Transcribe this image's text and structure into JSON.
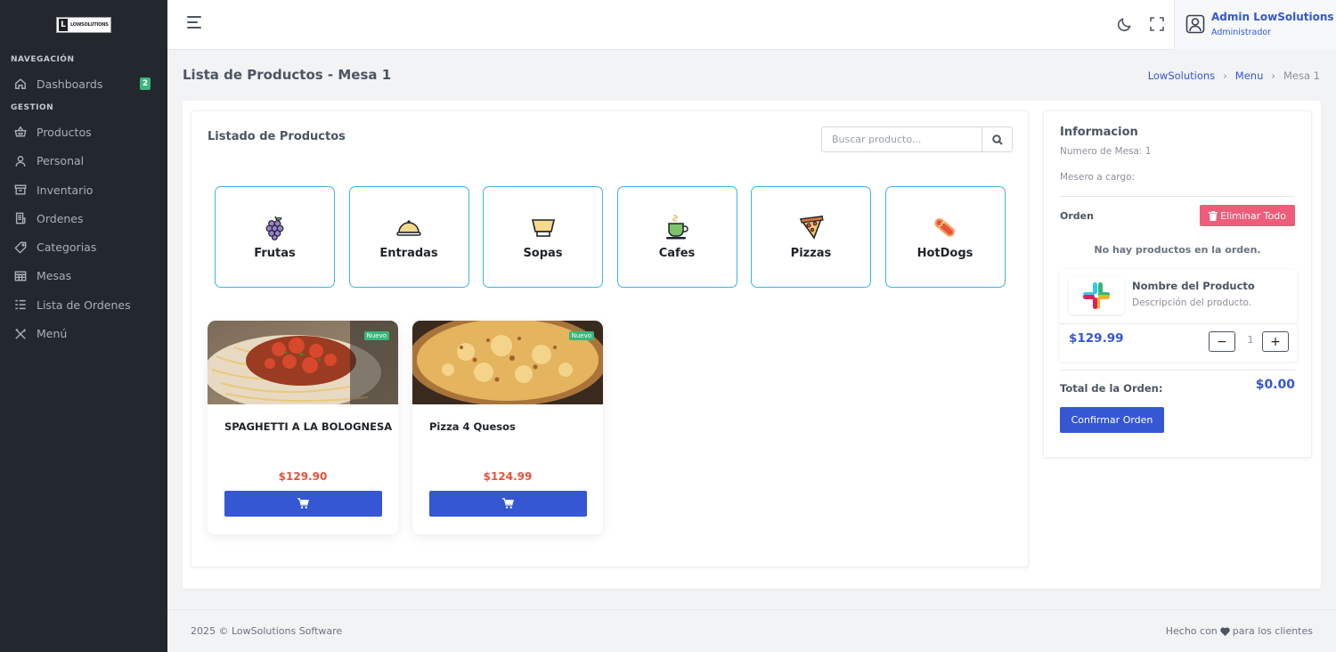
{
  "brand": {
    "logo_letter": "L",
    "logo_text": "LOWSOLUTIONS"
  },
  "sidebar": {
    "sections": [
      {
        "title": "NAVEGACIÓN"
      },
      {
        "title": "GESTION"
      }
    ],
    "items": [
      {
        "label": "Dashboards",
        "icon": "home-icon",
        "badge": "2"
      },
      {
        "label": "Productos",
        "icon": "basket-icon"
      },
      {
        "label": "Personal",
        "icon": "user-icon"
      },
      {
        "label": "Inventario",
        "icon": "archive-icon"
      },
      {
        "label": "Ordenes",
        "icon": "receipt-icon"
      },
      {
        "label": "Categorias",
        "icon": "tag-icon"
      },
      {
        "label": "Mesas",
        "icon": "table-icon"
      },
      {
        "label": "Lista de Ordenes",
        "icon": "list-icon"
      },
      {
        "label": "Menú",
        "icon": "utensils-icon"
      }
    ]
  },
  "topbar": {
    "user_name": "Admin LowSolutions",
    "user_role": "Administrador"
  },
  "page": {
    "title": "Lista de Productos - Mesa 1",
    "breadcrumb": [
      "LowSolutions",
      "Menu",
      "Mesa 1"
    ]
  },
  "products_panel": {
    "title": "Listado de Productos",
    "search_placeholder": "Buscar producto...",
    "categories": [
      {
        "label": "Frutas",
        "icon": "grapes-icon"
      },
      {
        "label": "Entradas",
        "icon": "cloche-icon"
      },
      {
        "label": "Sopas",
        "icon": "bowl-icon"
      },
      {
        "label": "Cafes",
        "icon": "coffee-icon"
      },
      {
        "label": "Pizzas",
        "icon": "pizza-icon"
      },
      {
        "label": "HotDogs",
        "icon": "hotdog-icon"
      }
    ],
    "products": [
      {
        "name": "SPAGHETTI A LA BOLOGNESA",
        "price": "$129.90",
        "badge": "Nuevo"
      },
      {
        "name": "Pizza 4 Quesos",
        "price": "$124.99",
        "badge": "Nuevo"
      }
    ]
  },
  "info_panel": {
    "title": "Informacion",
    "table_number": "Numero de Mesa: 1",
    "waiter": "Mesero a cargo:",
    "order_label": "Orden",
    "delete_all": "Eliminar Todo",
    "empty_message": "No hay productos en la orden.",
    "item": {
      "name": "Nombre del Producto",
      "description": "Descripción del producto.",
      "price": "$129.99",
      "quantity": "1"
    },
    "total_label": "Total de la Orden:",
    "total_value": "$0.00",
    "confirm": "Confirmar Orden"
  },
  "footer": {
    "left": "2025 © LowSolutions Software",
    "right_prefix": "Hecho con",
    "right_suffix": "para los clientes"
  },
  "colors": {
    "sidebar_bg": "#23272e",
    "primary": "#3557d4",
    "price_red": "#e5533c",
    "badge_green": "#3ab77b",
    "danger": "#ef5c7a",
    "category_border": "#3cb4e5"
  }
}
